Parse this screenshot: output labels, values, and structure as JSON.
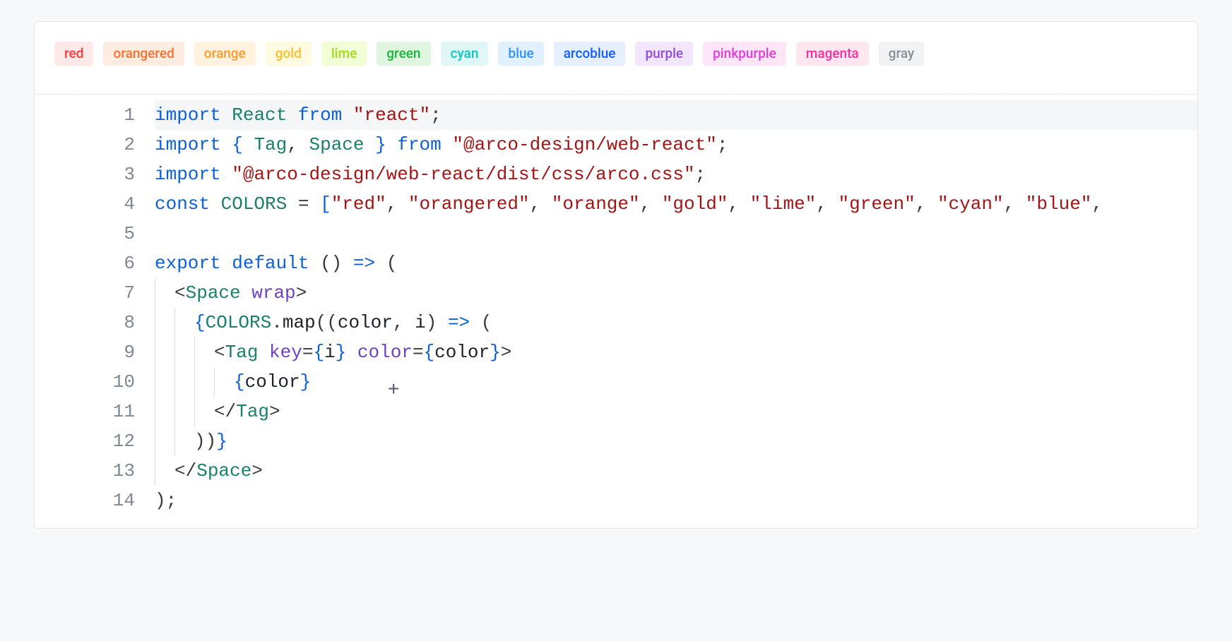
{
  "tags": [
    {
      "label": "red",
      "bg": "#ffe8e8",
      "fg": "#f53f3f"
    },
    {
      "label": "orangered",
      "bg": "#ffece1",
      "fg": "#f77234"
    },
    {
      "label": "orange",
      "bg": "#fff3e0",
      "fg": "#ff9a2e"
    },
    {
      "label": "gold",
      "bg": "#fffbe0",
      "fg": "#f7c034"
    },
    {
      "label": "lime",
      "bg": "#f2ffd6",
      "fg": "#9fdb1d"
    },
    {
      "label": "green",
      "bg": "#e0f5e0",
      "fg": "#1db440"
    },
    {
      "label": "cyan",
      "bg": "#e0f7f6",
      "fg": "#0fc6c2"
    },
    {
      "label": "blue",
      "bg": "#e0f0ff",
      "fg": "#3491fa"
    },
    {
      "label": "arcoblue",
      "bg": "#e6efff",
      "fg": "#165dff"
    },
    {
      "label": "purple",
      "bg": "#f2e6ff",
      "fg": "#8d4eda"
    },
    {
      "label": "pinkpurple",
      "bg": "#ffe6f6",
      "fg": "#e13edb"
    },
    {
      "label": "magenta",
      "bg": "#ffe6ef",
      "fg": "#f5319d"
    },
    {
      "label": "gray",
      "bg": "#f2f3f5",
      "fg": "#86909c"
    }
  ],
  "code": {
    "line_count": 14,
    "highlighted_line": 1,
    "cursor_icon": "+",
    "lines": {
      "l1": [
        [
          "kw",
          "import"
        ],
        [
          "plain",
          " "
        ],
        [
          "id",
          "React"
        ],
        [
          "plain",
          " "
        ],
        [
          "kw",
          "from"
        ],
        [
          "plain",
          " "
        ],
        [
          "str",
          "\"react\""
        ],
        [
          "pun",
          ";"
        ]
      ],
      "l2": [
        [
          "kw",
          "import"
        ],
        [
          "plain",
          " "
        ],
        [
          "br",
          "{"
        ],
        [
          "plain",
          " "
        ],
        [
          "id",
          "Tag"
        ],
        [
          "pun",
          ","
        ],
        [
          "plain",
          " "
        ],
        [
          "id",
          "Space"
        ],
        [
          "plain",
          " "
        ],
        [
          "br",
          "}"
        ],
        [
          "plain",
          " "
        ],
        [
          "kw",
          "from"
        ],
        [
          "plain",
          " "
        ],
        [
          "str",
          "\"@arco-design/web-react\""
        ],
        [
          "pun",
          ";"
        ]
      ],
      "l3": [
        [
          "kw",
          "import"
        ],
        [
          "plain",
          " "
        ],
        [
          "str",
          "\"@arco-design/web-react/dist/css/arco.css\""
        ],
        [
          "pun",
          ";"
        ]
      ],
      "l4": [
        [
          "kw",
          "const"
        ],
        [
          "plain",
          " "
        ],
        [
          "id",
          "COLORS"
        ],
        [
          "plain",
          " "
        ],
        [
          "pun",
          "="
        ],
        [
          "plain",
          " "
        ],
        [
          "br",
          "["
        ],
        [
          "str",
          "\"red\""
        ],
        [
          "pun",
          ","
        ],
        [
          "plain",
          " "
        ],
        [
          "str",
          "\"orangered\""
        ],
        [
          "pun",
          ","
        ],
        [
          "plain",
          " "
        ],
        [
          "str",
          "\"orange\""
        ],
        [
          "pun",
          ","
        ],
        [
          "plain",
          " "
        ],
        [
          "str",
          "\"gold\""
        ],
        [
          "pun",
          ","
        ],
        [
          "plain",
          " "
        ],
        [
          "str",
          "\"lime\""
        ],
        [
          "pun",
          ","
        ],
        [
          "plain",
          " "
        ],
        [
          "str",
          "\"green\""
        ],
        [
          "pun",
          ","
        ],
        [
          "plain",
          " "
        ],
        [
          "str",
          "\"cyan\""
        ],
        [
          "pun",
          ","
        ],
        [
          "plain",
          " "
        ],
        [
          "str",
          "\"blue\""
        ],
        [
          "pun",
          ","
        ]
      ],
      "l5": [],
      "l6": [
        [
          "kw",
          "export"
        ],
        [
          "plain",
          " "
        ],
        [
          "kw",
          "default"
        ],
        [
          "plain",
          " "
        ],
        [
          "pun",
          "()"
        ],
        [
          "plain",
          " "
        ],
        [
          "br",
          "=>"
        ],
        [
          "plain",
          " "
        ],
        [
          "pun",
          "("
        ]
      ],
      "l7": [
        [
          "plain",
          "  "
        ],
        [
          "pun",
          "<"
        ],
        [
          "jx",
          "Space"
        ],
        [
          "plain",
          " "
        ],
        [
          "at",
          "wrap"
        ],
        [
          "pun",
          ">"
        ]
      ],
      "l8": [
        [
          "plain",
          "    "
        ],
        [
          "br",
          "{"
        ],
        [
          "id",
          "COLORS"
        ],
        [
          "pun",
          "."
        ],
        [
          "var",
          "map"
        ],
        [
          "pun",
          "(("
        ],
        [
          "var",
          "color"
        ],
        [
          "pun",
          ","
        ],
        [
          "plain",
          " "
        ],
        [
          "var",
          "i"
        ],
        [
          "pun",
          ")"
        ],
        [
          "plain",
          " "
        ],
        [
          "br",
          "=>"
        ],
        [
          "plain",
          " "
        ],
        [
          "pun",
          "("
        ]
      ],
      "l9": [
        [
          "plain",
          "      "
        ],
        [
          "pun",
          "<"
        ],
        [
          "jx",
          "Tag"
        ],
        [
          "plain",
          " "
        ],
        [
          "at",
          "key"
        ],
        [
          "pun",
          "="
        ],
        [
          "br",
          "{"
        ],
        [
          "var",
          "i"
        ],
        [
          "br",
          "}"
        ],
        [
          "plain",
          " "
        ],
        [
          "at",
          "color"
        ],
        [
          "pun",
          "="
        ],
        [
          "br",
          "{"
        ],
        [
          "var",
          "color"
        ],
        [
          "br",
          "}"
        ],
        [
          "pun",
          ">"
        ]
      ],
      "l10": [
        [
          "plain",
          "        "
        ],
        [
          "br",
          "{"
        ],
        [
          "var",
          "color"
        ],
        [
          "br",
          "}"
        ]
      ],
      "l11": [
        [
          "plain",
          "      "
        ],
        [
          "pun",
          "</"
        ],
        [
          "jx",
          "Tag"
        ],
        [
          "pun",
          ">"
        ]
      ],
      "l12": [
        [
          "plain",
          "    "
        ],
        [
          "pun",
          "))"
        ],
        [
          "br",
          "}"
        ]
      ],
      "l13": [
        [
          "plain",
          "  "
        ],
        [
          "pun",
          "</"
        ],
        [
          "jx",
          "Space"
        ],
        [
          "pun",
          ">"
        ]
      ],
      "l14": [
        [
          "pun",
          ")"
        ],
        [
          "pun",
          ";"
        ]
      ]
    }
  }
}
